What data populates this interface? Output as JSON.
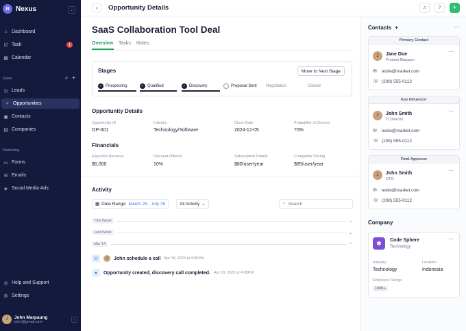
{
  "sidebar": {
    "brand": "Nexus",
    "logo_letter": "N",
    "nav_main": [
      {
        "label": "Dashboard",
        "icon": "home-icon"
      },
      {
        "label": "Task",
        "icon": "checklist-icon",
        "badge": "1"
      },
      {
        "label": "Calendar",
        "icon": "calendar-icon"
      }
    ],
    "sales_label": "Sales",
    "nav_sales": [
      {
        "label": "Leads",
        "icon": "leads-icon"
      },
      {
        "label": "Opportunities",
        "icon": "tag-icon"
      },
      {
        "label": "Contacts",
        "icon": "contacts-icon"
      },
      {
        "label": "Companies",
        "icon": "building-icon"
      }
    ],
    "marketing_label": "Marketing",
    "nav_marketing": [
      {
        "label": "Forms",
        "icon": "form-icon"
      },
      {
        "label": "Emails",
        "icon": "mail-icon"
      },
      {
        "label": "Social Media Ads",
        "icon": "megaphone-icon"
      }
    ],
    "nav_bottom": [
      {
        "label": "Help and Support",
        "icon": "help-icon"
      },
      {
        "label": "Settings",
        "icon": "gear-icon"
      }
    ],
    "user": {
      "name": "John Marpaung",
      "email": "john@gmail.com"
    }
  },
  "header": {
    "title": "Opportunity Details"
  },
  "deal": {
    "title": "SaaS Collaboration Tool Deal",
    "tabs": [
      "Overview",
      "Tasks",
      "Notes"
    ],
    "stages_label": "Stages",
    "next_stage_button": "Move to Next Stage",
    "stages": [
      {
        "label": "Prospecting",
        "state": "done"
      },
      {
        "label": "Qualified",
        "state": "done"
      },
      {
        "label": "Discovery",
        "state": "done"
      },
      {
        "label": "Proposal Sent",
        "state": "current"
      },
      {
        "label": "Negotiation",
        "state": "pending"
      },
      {
        "label": "Closed",
        "state": "pending"
      }
    ],
    "details_heading": "Opportunity Details",
    "details": [
      {
        "label": "Opportunity ID",
        "value": "OP-001"
      },
      {
        "label": "Industry",
        "value": "Technology/Software"
      },
      {
        "label": "Close Date",
        "value": "2024-12-05"
      },
      {
        "label": "Probability of Closure",
        "value": "70%"
      }
    ],
    "financials_heading": "Financials",
    "financials": [
      {
        "label": "Expected Revenue",
        "value": "$6,000"
      },
      {
        "label": "Discount Offered",
        "value": "10%"
      },
      {
        "label": "Subscription Details",
        "value": "$80/user/year"
      },
      {
        "label": "Competitor Pricing",
        "value": "$85/user/year"
      }
    ]
  },
  "activity": {
    "heading": "Activity",
    "date_range_label": "Date Range:",
    "date_range_value": "March 25 - July 25",
    "filter": "All Activity",
    "search_placeholder": "Search",
    "groups": [
      "This Week",
      "Last Week",
      "Mar 14"
    ],
    "items": [
      {
        "text": "John schedule a call",
        "time": "Apr 18, 2023 at 4:05PM"
      },
      {
        "text": "Opportunity created, discovery call completed.",
        "time": "Apr 18, 2023 at 4:05PM"
      }
    ]
  },
  "contacts": {
    "heading": "Contacts",
    "cards": [
      {
        "role_title": "Primary Contact",
        "name": "Jane Doe",
        "position": "Product Manager",
        "email": "leslie@market.com",
        "phone": "(208) 555-0112"
      },
      {
        "role_title": "Key Influencer",
        "name": "John Smith",
        "position": "IT Director",
        "email": "leslie@market.com",
        "phone": "(208) 555-0112"
      },
      {
        "role_title": "Final Approver",
        "name": "John Smith",
        "position": "CTO",
        "email": "leslie@market.com",
        "phone": "(208) 555-0112"
      }
    ]
  },
  "company": {
    "heading": "Company",
    "name": "Code Sphere",
    "sub": "Technology",
    "industry_label": "Industry",
    "industry": "Technology",
    "location_label": "Location",
    "location": "Indonesia",
    "size_label": "Employee Range",
    "size": "100K+"
  },
  "colors": {
    "sidebar": "#131a3b",
    "accent": "#1f9d59",
    "link": "#2f80ed",
    "company_logo": "#7c4ddb"
  }
}
